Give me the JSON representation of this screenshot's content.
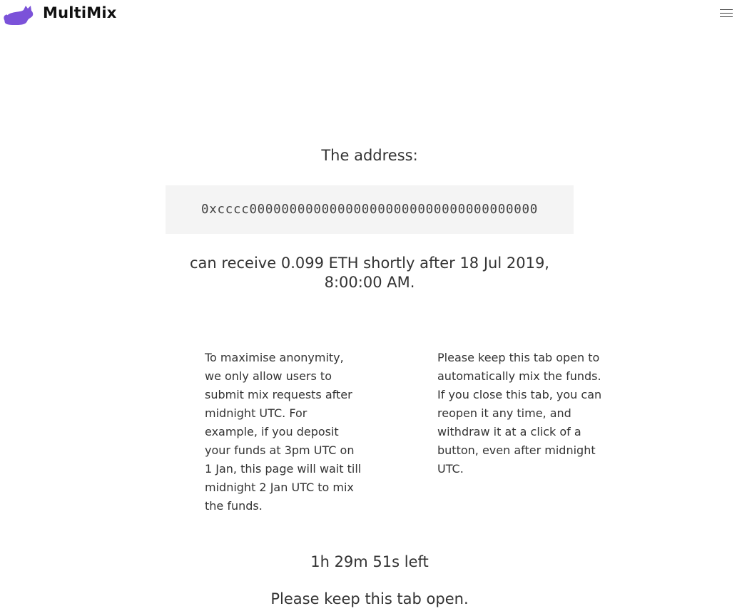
{
  "header": {
    "brand": "MultiMix",
    "logo_icon": "cat-icon",
    "menu_icon": "hamburger-menu-icon",
    "logo_color": "#7b52d9"
  },
  "main": {
    "address_heading": "The address:",
    "address": "0xcccc000000000000000000000000000000000000",
    "receive_text": "can receive 0.099 ETH shortly after 18 Jul 2019, 8:00:00 AM.",
    "info_left": "To maximise anonymity, we only allow users to submit mix requests after midnight UTC. For example, if you deposit your funds at 3pm UTC on 1 Jan, this page will wait till midnight 2 Jan UTC to mix the funds.",
    "info_right": "Please keep this tab open to automatically mix the funds. If you close this tab, you can reopen it any time, and withdraw it at a click of a button, even after midnight UTC.",
    "countdown": "1h 29m 51s left",
    "keep_open": "Please keep this tab open."
  }
}
